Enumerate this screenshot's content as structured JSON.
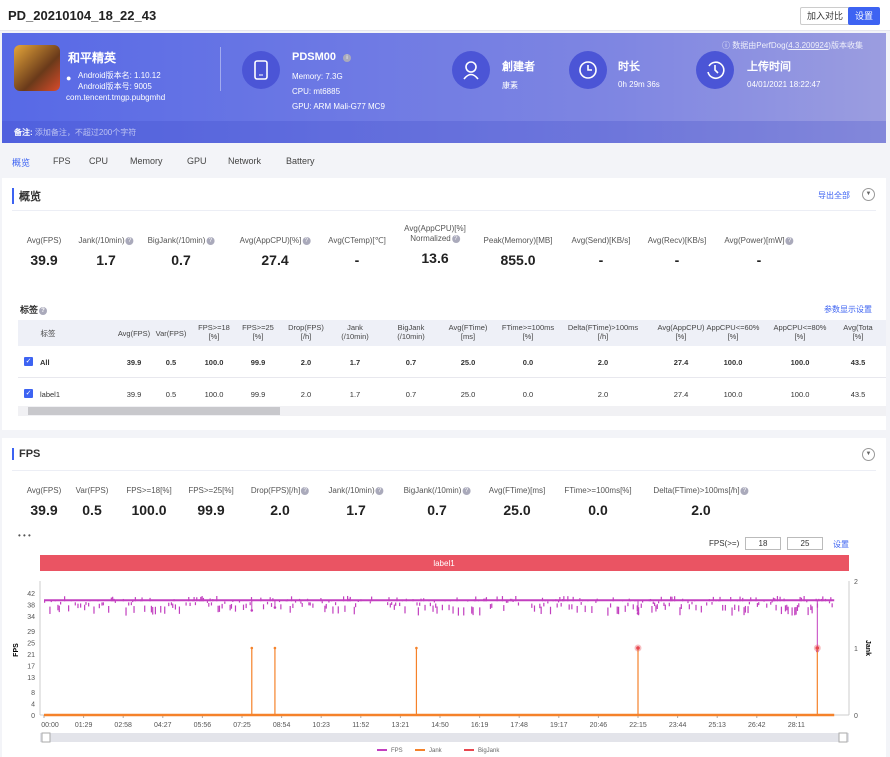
{
  "window": {
    "title": "PD_20210104_18_22_43",
    "compare_button": "加入对比",
    "settings_button": "设置"
  },
  "header": {
    "game_name": "和平精英",
    "android_version_name": "Android版本名: 1.10.12",
    "android_version_code": "Android版本号: 9005",
    "package": "com.tencent.tmgp.pubgmhd",
    "device": {
      "name": "PDSM00",
      "memory": "Memory: 7.3G",
      "cpu": "CPU: mt6885",
      "gpu": "GPU: ARM Mali-G77 MC9"
    },
    "creator": {
      "label": "創建者",
      "value": "康素"
    },
    "duration": {
      "label": "时长",
      "value": "0h 29m 36s"
    },
    "upload": {
      "label": "上传时间",
      "value": "04/01/2021 18:22:47"
    },
    "version_prefix": "数据由PerfDog(",
    "version": "4.3.200924",
    "version_suffix": ")版本收集",
    "note_label": "备注:",
    "note_placeholder": "添加备注，不超过200个字符"
  },
  "tabs": [
    {
      "label": "概览",
      "active": true
    },
    {
      "label": "FPS"
    },
    {
      "label": "CPU"
    },
    {
      "label": "Memory"
    },
    {
      "label": "GPU"
    },
    {
      "label": "Network"
    },
    {
      "label": "Battery"
    }
  ],
  "overview": {
    "title": "概览",
    "export_label": "导出全部",
    "metrics": [
      {
        "label": "Avg(FPS)",
        "value": "39.9"
      },
      {
        "label": "Jank(/10min)",
        "value": "1.7",
        "help": true
      },
      {
        "label": "BigJank(/10min)",
        "value": "0.7",
        "help": true
      },
      {
        "label": "Avg(AppCPU)[%]",
        "value": "27.4",
        "help": true
      },
      {
        "label": "Avg(CTemp)[℃]",
        "value": "-"
      },
      {
        "label": "Avg(AppCPU)[%]",
        "label2": "Normalized",
        "value": "13.6",
        "help": true
      },
      {
        "label": "Peak(Memory)[MB]",
        "value": "855.0"
      },
      {
        "label": "Avg(Send)[KB/s]",
        "value": "-"
      },
      {
        "label": "Avg(Recv)[KB/s]",
        "value": "-"
      },
      {
        "label": "Avg(Power)[mW]",
        "value": "-",
        "help": true
      }
    ],
    "labels_title": "标签",
    "param_settings": "参数显示设置",
    "table": {
      "columns": [
        [
          "标签",
          ""
        ],
        [
          "Avg(FPS)",
          ""
        ],
        [
          "Var(FPS)",
          ""
        ],
        [
          "FPS>=18",
          "[%]"
        ],
        [
          "FPS>=25",
          "[%]"
        ],
        [
          "Drop(FPS)",
          "[/h]"
        ],
        [
          "Jank",
          "(/10min)"
        ],
        [
          "BigJank",
          "(/10min)"
        ],
        [
          "Avg(FTime)",
          "[ms]"
        ],
        [
          "FTime>=100ms",
          "[%]"
        ],
        [
          "Delta(FTime)>100ms",
          "[/h]"
        ],
        [
          "Avg(AppCPU)",
          "[%]"
        ],
        [
          "AppCPU<=60%",
          "[%]"
        ],
        [
          "AppCPU<=80%",
          "[%]"
        ],
        [
          "Avg(Tota",
          "[%]"
        ]
      ],
      "rows": [
        [
          "All",
          "39.9",
          "0.5",
          "100.0",
          "99.9",
          "2.0",
          "1.7",
          "0.7",
          "25.0",
          "0.0",
          "2.0",
          "27.4",
          "100.0",
          "100.0",
          "43.5"
        ],
        [
          "label1",
          "39.9",
          "0.5",
          "100.0",
          "99.9",
          "2.0",
          "1.7",
          "0.7",
          "25.0",
          "0.0",
          "2.0",
          "27.4",
          "100.0",
          "100.0",
          "43.5"
        ]
      ]
    }
  },
  "fps_section": {
    "title": "FPS",
    "metrics": [
      {
        "label": "Avg(FPS)",
        "value": "39.9"
      },
      {
        "label": "Var(FPS)",
        "value": "0.5"
      },
      {
        "label": "FPS>=18[%]",
        "value": "100.0"
      },
      {
        "label": "FPS>=25[%]",
        "value": "99.9"
      },
      {
        "label": "Drop(FPS)[/h]",
        "value": "2.0",
        "help": true
      },
      {
        "label": "Jank(/10min)",
        "value": "1.7",
        "help": true
      },
      {
        "label": "BigJank(/10min)",
        "value": "0.7",
        "help": true
      },
      {
        "label": "Avg(FTime)[ms]",
        "value": "25.0"
      },
      {
        "label": "FTime>=100ms[%]",
        "value": "0.0"
      },
      {
        "label": "Delta(FTime)>100ms[/h]",
        "value": "2.0",
        "help": true
      }
    ],
    "threshold_label": "FPS(>=)",
    "threshold_1": "18",
    "threshold_2": "25",
    "apply_label": "设置"
  },
  "chart_data": {
    "type": "line",
    "label_band": "label1",
    "ylabel": "FPS",
    "y2label": "Jank",
    "yticks": [
      0,
      4,
      8,
      13,
      17,
      21,
      25,
      29,
      34,
      38,
      42
    ],
    "ylim": [
      0,
      46
    ],
    "y2ticks": [
      0,
      1,
      2
    ],
    "y2lim": [
      0,
      2
    ],
    "xticks": [
      "00:00",
      "01:29",
      "02:58",
      "04:27",
      "05:56",
      "07:25",
      "08:54",
      "10:23",
      "11:52",
      "13:21",
      "14:50",
      "16:19",
      "17:48",
      "19:17",
      "20:46",
      "22:15",
      "23:44",
      "25:13",
      "26:42",
      "28:11"
    ],
    "xlim": [
      "00:00",
      "29:36"
    ],
    "series": [
      {
        "name": "FPS",
        "color": "#c23fbf",
        "baseline": 39.5,
        "typical_range": [
          37,
          41
        ],
        "dips": [
          {
            "t": "07:47",
            "v": 36
          },
          {
            "t": "08:39",
            "v": 37
          },
          {
            "t": "22:15",
            "v": 35
          },
          {
            "t": "28:58",
            "v": 22
          }
        ]
      },
      {
        "name": "Jank",
        "color": "#f5822a",
        "axis": "right",
        "events": [
          {
            "t": "07:47",
            "v": 1
          },
          {
            "t": "08:39",
            "v": 1
          },
          {
            "t": "13:57",
            "v": 1
          },
          {
            "t": "22:15",
            "v": 1
          },
          {
            "t": "28:58",
            "v": 1
          }
        ]
      },
      {
        "name": "BigJank",
        "color": "#e8474f",
        "axis": "right",
        "events": [
          {
            "t": "22:15",
            "v": 1
          },
          {
            "t": "28:58",
            "v": 1
          }
        ]
      }
    ],
    "grid": false,
    "legend": "bottom"
  }
}
